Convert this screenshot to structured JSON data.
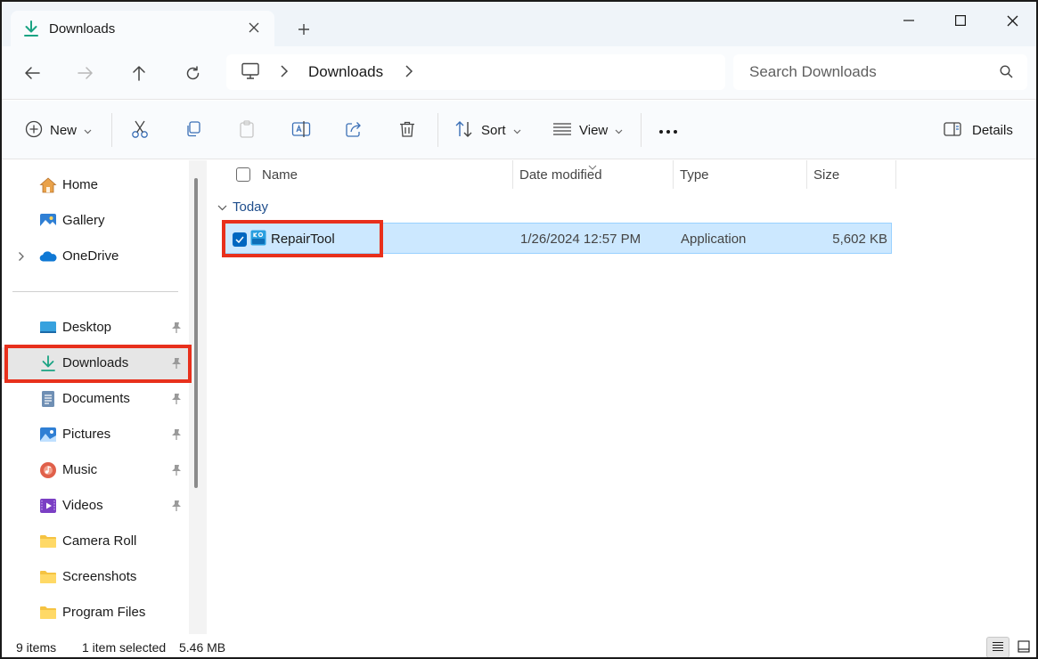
{
  "tab": {
    "title": "Downloads"
  },
  "breadcrumb": {
    "location": "Downloads"
  },
  "search": {
    "placeholder": "Search Downloads"
  },
  "toolbar": {
    "new_label": "New",
    "sort_label": "Sort",
    "view_label": "View",
    "details_label": "Details"
  },
  "sidebar": {
    "quick": [
      {
        "label": "Home",
        "icon": "home-icon"
      },
      {
        "label": "Gallery",
        "icon": "gallery-icon"
      },
      {
        "label": "OneDrive",
        "icon": "onedrive-icon"
      }
    ],
    "pinned": [
      {
        "label": "Desktop",
        "icon": "desktop-folder-icon",
        "pinned": true
      },
      {
        "label": "Downloads",
        "icon": "downloads-folder-icon",
        "pinned": true,
        "selected": true
      },
      {
        "label": "Documents",
        "icon": "documents-folder-icon",
        "pinned": true
      },
      {
        "label": "Pictures",
        "icon": "pictures-folder-icon",
        "pinned": true
      },
      {
        "label": "Music",
        "icon": "music-folder-icon",
        "pinned": true
      },
      {
        "label": "Videos",
        "icon": "videos-folder-icon",
        "pinned": true
      },
      {
        "label": "Camera Roll",
        "icon": "folder-icon"
      },
      {
        "label": "Screenshots",
        "icon": "folder-icon"
      },
      {
        "label": "Program Files",
        "icon": "folder-icon"
      }
    ]
  },
  "columns": {
    "name": "Name",
    "date": "Date modified",
    "type": "Type",
    "size": "Size"
  },
  "group": {
    "label": "Today"
  },
  "files": [
    {
      "name": "RepairTool",
      "date": "1/26/2024 12:57 PM",
      "type": "Application",
      "size": "5,602 KB",
      "selected": true
    }
  ],
  "status": {
    "count": "9 items",
    "selection": "1 item selected",
    "size": "5.46 MB"
  },
  "colors": {
    "accent": "#0067c0",
    "selection_bg": "#cce8ff",
    "annotation": "#e8301c"
  }
}
